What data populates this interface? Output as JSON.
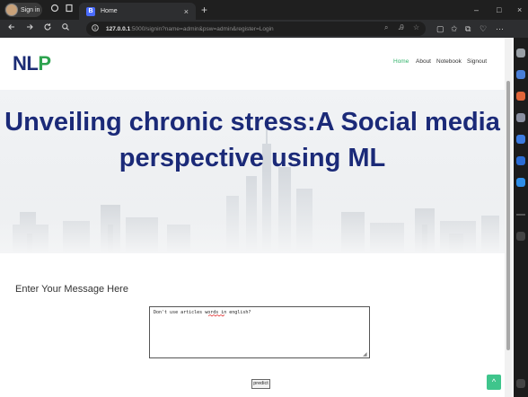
{
  "browser": {
    "profile_label": "Sign in",
    "tab_title": "Home",
    "tab_favicon": "B",
    "new_tab_symbol": "+",
    "close_symbol": "×",
    "url_host": "127.0.0.1",
    "url_rest": ":5000/signin?name=admin&psw=admin&register=Login",
    "window_controls": [
      "–",
      "□",
      "×"
    ],
    "icons": {
      "back": "back-arrow-icon",
      "forward": "forward-arrow-icon",
      "reload": "reload-icon",
      "search": "search-icon",
      "info": "info-icon"
    }
  },
  "site": {
    "logo_main": "NL",
    "logo_accent": "P",
    "nav": [
      {
        "label": "Home",
        "active": true
      },
      {
        "label": "About",
        "active": false
      },
      {
        "label": "Notebook",
        "active": false
      },
      {
        "label": "Signout",
        "active": false
      }
    ],
    "hero_title_line1": "Unveiling chronic stress:A Social media",
    "hero_title_line2": "perspective using ML"
  },
  "form": {
    "label": "Enter Your Message Here",
    "message_value": "Don't use articles words in english?",
    "predict_label": "predict",
    "to_top_symbol": "^"
  },
  "colors": {
    "brand_navy": "#1b2a78",
    "logo_green": "#2ea34f",
    "nav_active": "#33b36b",
    "to_top_bg": "#3fc58c"
  }
}
